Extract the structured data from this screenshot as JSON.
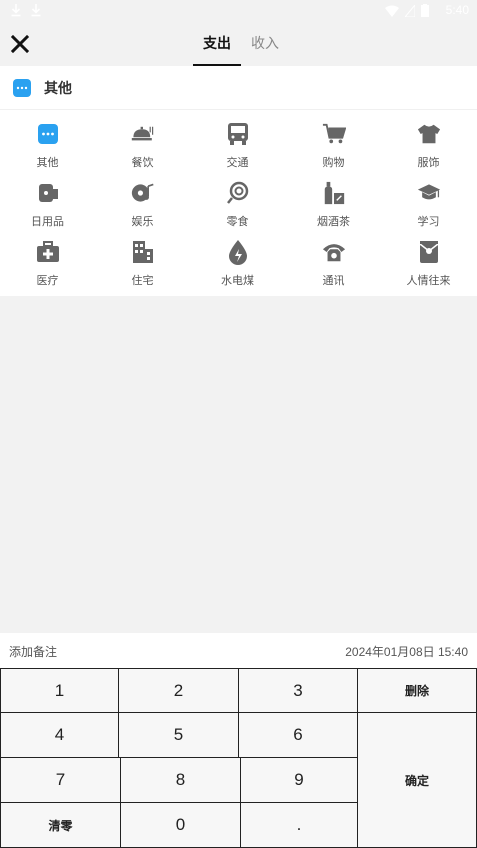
{
  "status": {
    "time": "5:40"
  },
  "header": {
    "tabs": [
      {
        "label": "支出",
        "active": true
      },
      {
        "label": "收入",
        "active": false
      }
    ]
  },
  "selected_category": {
    "label": "其他",
    "icon": "dots-icon"
  },
  "categories": [
    {
      "label": "其他",
      "icon": "dots-icon"
    },
    {
      "label": "餐饮",
      "icon": "dining-icon"
    },
    {
      "label": "交通",
      "icon": "bus-icon"
    },
    {
      "label": "购物",
      "icon": "cart-icon"
    },
    {
      "label": "服饰",
      "icon": "shirt-icon"
    },
    {
      "label": "日用品",
      "icon": "tissue-icon"
    },
    {
      "label": "娱乐",
      "icon": "music-icon"
    },
    {
      "label": "零食",
      "icon": "lollipop-icon"
    },
    {
      "label": "烟酒茶",
      "icon": "bottle-icon"
    },
    {
      "label": "学习",
      "icon": "graduation-cap-icon"
    },
    {
      "label": "医疗",
      "icon": "medical-kit-icon"
    },
    {
      "label": "住宅",
      "icon": "building-icon"
    },
    {
      "label": "水电煤",
      "icon": "utilities-icon"
    },
    {
      "label": "通讯",
      "icon": "phone-icon"
    },
    {
      "label": "人情往来",
      "icon": "gift-icon"
    }
  ],
  "note": {
    "placeholder": "添加备注",
    "datetime": "2024年01月08日 15:40"
  },
  "keypad": {
    "k1": "1",
    "k2": "2",
    "k3": "3",
    "k4": "4",
    "k5": "5",
    "k6": "6",
    "k7": "7",
    "k8": "8",
    "k9": "9",
    "k0": "0",
    "dot": ".",
    "delete": "删除",
    "confirm": "确定",
    "clear": "清零"
  },
  "colors": {
    "accent": "#2aa1f0",
    "icon_gray": "#666666"
  }
}
